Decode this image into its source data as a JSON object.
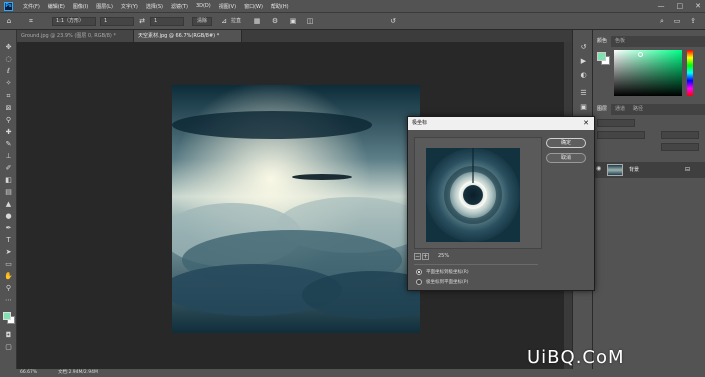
{
  "menubar": {
    "logo": "Ps",
    "items": [
      "文件(F)",
      "编辑(E)",
      "图像(I)",
      "图层(L)",
      "文字(Y)",
      "选择(S)",
      "滤镜(T)",
      "3D(D)",
      "视图(V)",
      "窗口(W)",
      "帮助(H)"
    ],
    "minimize": "—",
    "restore": "□",
    "close": "✕"
  },
  "options": {
    "ratio": "1:1（方形）",
    "width_value": "1",
    "height_value": "1",
    "clear_label": "清除",
    "straighten_label": "拉直"
  },
  "tabs": [
    {
      "label": "Ground.jpg @ 23.9% (图层 0, RGB/8) *"
    },
    {
      "label": "天空素材.jpg @ 66.7%(RGB/8#) *"
    }
  ],
  "dialog": {
    "title": "极坐标",
    "close": "✕",
    "ok_label": "确定",
    "cancel_label": "取消",
    "zoom_value": "25%",
    "zoom_minus": "−",
    "zoom_plus": "+",
    "option1": "平面坐标到极坐标(R)",
    "option2": "极坐标到平面坐标(P)",
    "option1_selected": true
  },
  "right_panel": {
    "color_tab": "颜色",
    "swatches_tab": "色板",
    "layers_tab": "图层",
    "channels_tab": "通道",
    "paths_tab": "路径",
    "layer_name": "背景",
    "fg_color": "#7fe0b0",
    "bg_color": "#ffffff"
  },
  "status": {
    "zoom": "66.67%",
    "doc": "文档:2.94M/2.94M"
  },
  "watermark": "UiBQ.CoM"
}
